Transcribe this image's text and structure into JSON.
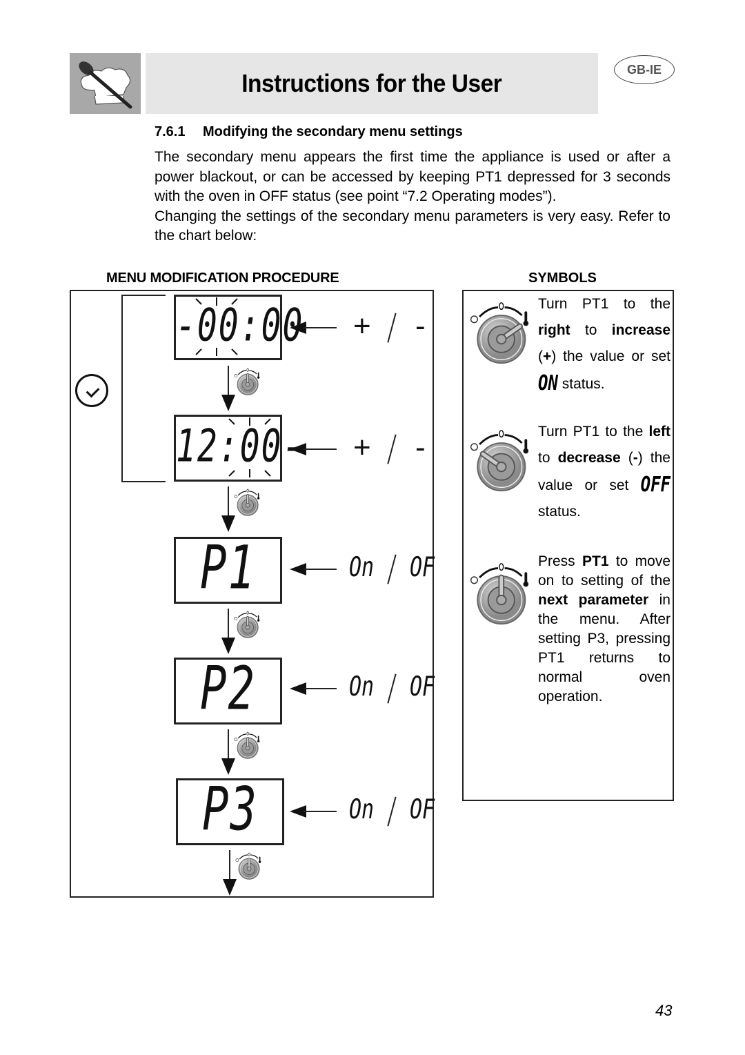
{
  "header": {
    "title": "Instructions for the User",
    "language_badge": "GB-IE",
    "logo_icon": "spoon-and-chef-hat-icon"
  },
  "section": {
    "number": "7.6.1",
    "title": "Modifying the secondary menu settings",
    "paragraphs": [
      "The secondary menu appears the first time the appliance is used or after a power blackout, or can be accessed by keeping PT1 depressed for 3 seconds with the oven in OFF status (see point “7.2 Operating modes”).",
      "Changing the settings of the secondary menu parameters is very easy. Refer to the chart below:"
    ]
  },
  "procedure": {
    "heading": "MENU MODIFICATION PROCEDURE",
    "side_icon": "clock-icon",
    "steps": [
      {
        "display": "-00:00",
        "blinking": true,
        "options": [
          "+",
          "-"
        ]
      },
      {
        "display": "12:00-",
        "blinking": true,
        "options": [
          "+",
          "-"
        ]
      },
      {
        "display": "P1",
        "blinking": false,
        "options": [
          "On",
          "OF"
        ]
      },
      {
        "display": "P2",
        "blinking": false,
        "options": [
          "On",
          "OF"
        ]
      },
      {
        "display": "P3",
        "blinking": false,
        "options": [
          "On",
          "OF"
        ]
      }
    ],
    "transition_icon": "pt1-knob-icon"
  },
  "symbols": {
    "heading": "SYMBOLS",
    "items": [
      {
        "icon": "knob-turn-right-icon",
        "parts": [
          {
            "t": "Turn PT1 to the ",
            "b": false
          },
          {
            "t": "right",
            "b": true
          },
          {
            "t": " to ",
            "b": false
          },
          {
            "t": "increase",
            "b": true
          },
          {
            "t": " (",
            "b": false
          },
          {
            "t": "+",
            "b": true
          },
          {
            "t": ") the value or set ",
            "b": false
          },
          {
            "t": "ON",
            "lcd": true
          },
          {
            "t": " status.",
            "b": false
          }
        ]
      },
      {
        "icon": "knob-turn-left-icon",
        "parts": [
          {
            "t": "Turn PT1 to the ",
            "b": false
          },
          {
            "t": "left",
            "b": true
          },
          {
            "t": " to ",
            "b": false
          },
          {
            "t": "decrease",
            "b": true
          },
          {
            "t": " (",
            "b": false
          },
          {
            "t": "-",
            "b": true
          },
          {
            "t": ") the value or set ",
            "b": false
          },
          {
            "t": "OFF",
            "lcd": true
          },
          {
            "t": " status.",
            "b": false
          }
        ]
      },
      {
        "icon": "knob-press-icon",
        "parts": [
          {
            "t": "Press ",
            "b": false
          },
          {
            "t": "PT1",
            "b": true
          },
          {
            "t": " to move on to setting of the ",
            "b": false
          },
          {
            "t": "next parameter",
            "b": true
          },
          {
            "t": " in the menu. After setting P3, pressing PT1 returns to normal oven operation.",
            "b": false
          }
        ]
      }
    ]
  },
  "footer": {
    "page_number": "43"
  }
}
